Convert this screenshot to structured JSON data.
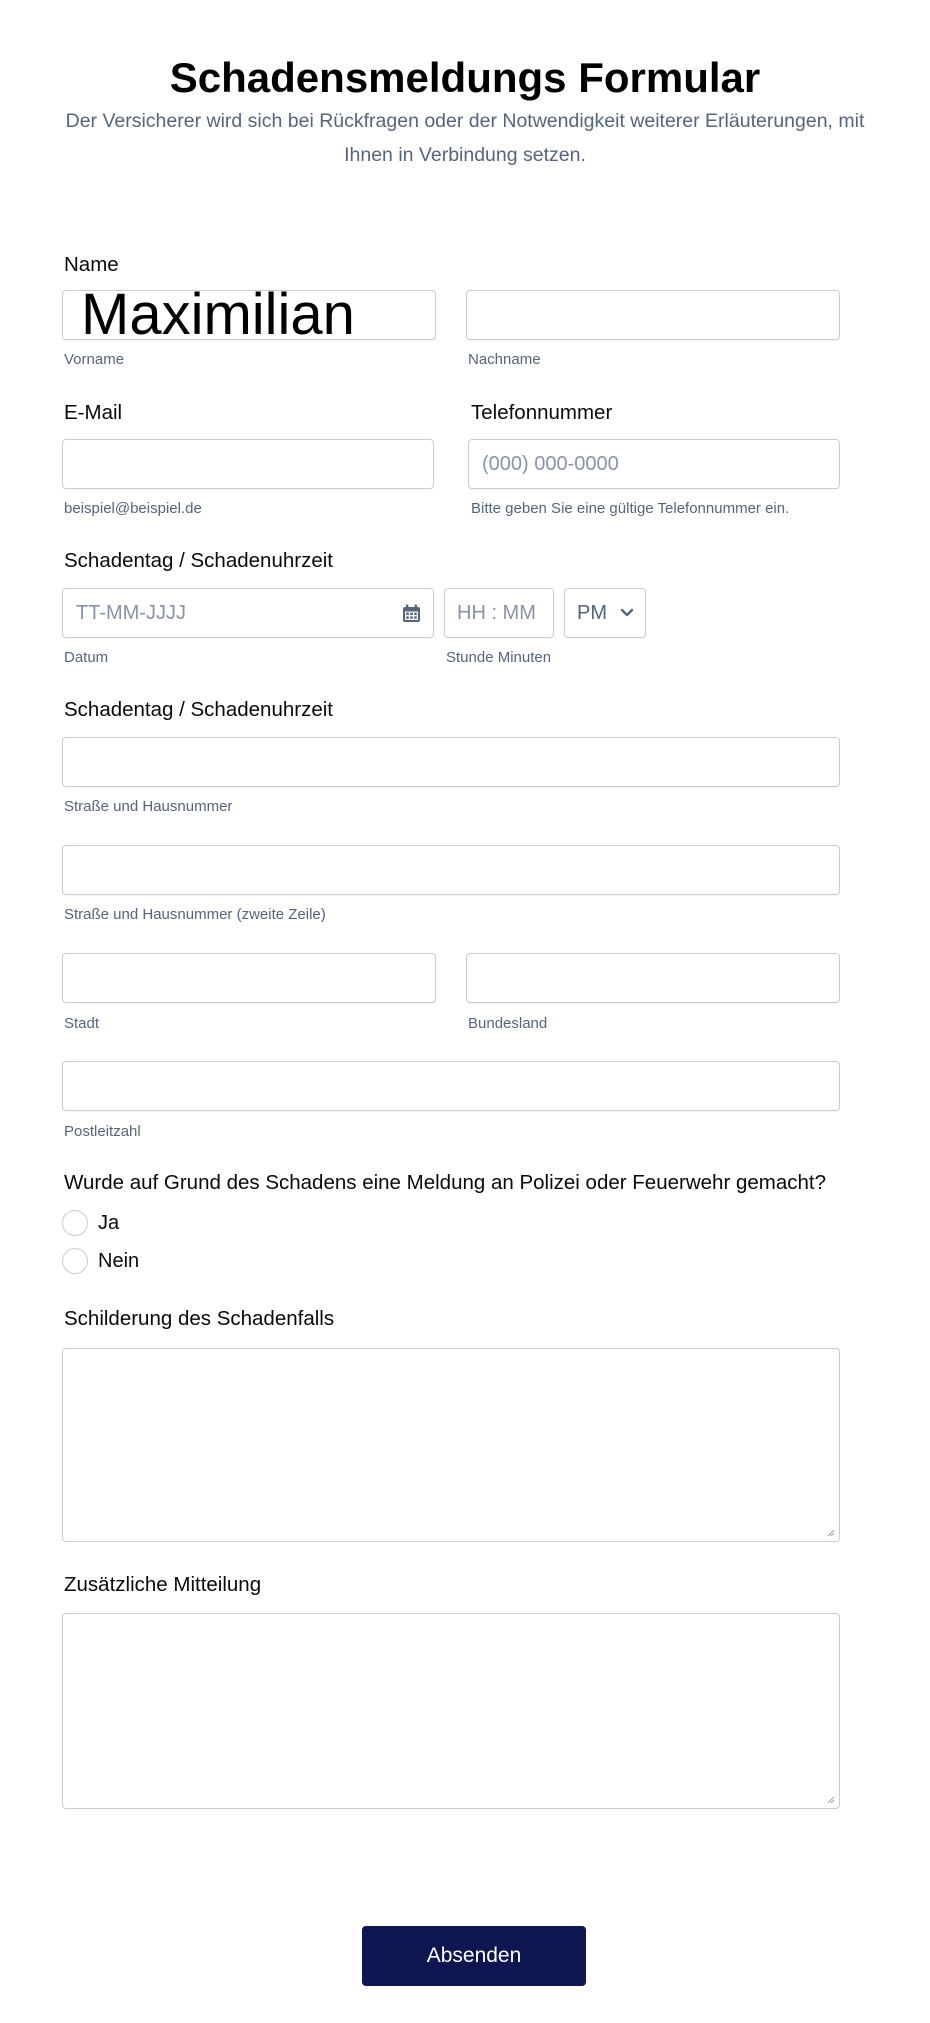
{
  "form": {
    "title": "Schadensmeldungs Formular",
    "subtitle": "Der Versicherer wird sich bei Rückfragen oder der Notwendigkeit weiterer Erläuterungen, mit Ihnen in Verbindung setzen."
  },
  "name": {
    "label": "Name",
    "first_value": "Maximilian",
    "first_sublabel": "Vorname",
    "last_value": "",
    "last_sublabel": "Nachname"
  },
  "email": {
    "label": "E-Mail",
    "value": "",
    "sublabel": "beispiel@beispiel.de"
  },
  "phone": {
    "label": "Telefonnummer",
    "placeholder": "(000) 000-0000",
    "sublabel": "Bitte geben Sie eine gültige Telefonnummer ein."
  },
  "datetime": {
    "label": "Schadentag / Schadenuhrzeit",
    "date_placeholder": "TT-MM-JJJJ",
    "date_sublabel": "Datum",
    "time_placeholder": "HH : MM",
    "time_sublabel": "Stunde Minuten",
    "ampm_value": "PM",
    "calendar_icon": "calendar-icon",
    "chevron_icon": "chevron-down-icon"
  },
  "address": {
    "label": "Schadentag / Schadenuhrzeit",
    "street_sublabel": "Straße und Hausnummer",
    "street2_sublabel": "Straße und Hausnummer (zweite Zeile)",
    "city_sublabel": "Stadt",
    "state_sublabel": "Bundesland",
    "zip_sublabel": "Postleitzahl"
  },
  "report": {
    "question": "Wurde auf Grund des Schadens eine Meldung an Polizei oder Feuerwehr gemacht?",
    "option_yes": "Ja",
    "option_no": "Nein"
  },
  "description": {
    "label": "Schilderung des Schadenfalls",
    "value": ""
  },
  "additional": {
    "label": "Zusätzliche Mitteilung",
    "value": ""
  },
  "actions": {
    "submit_label": "Absenden"
  },
  "colors": {
    "submit_bg": "#0e1651",
    "muted_text": "#57647e",
    "border": "#c9ccd4"
  }
}
